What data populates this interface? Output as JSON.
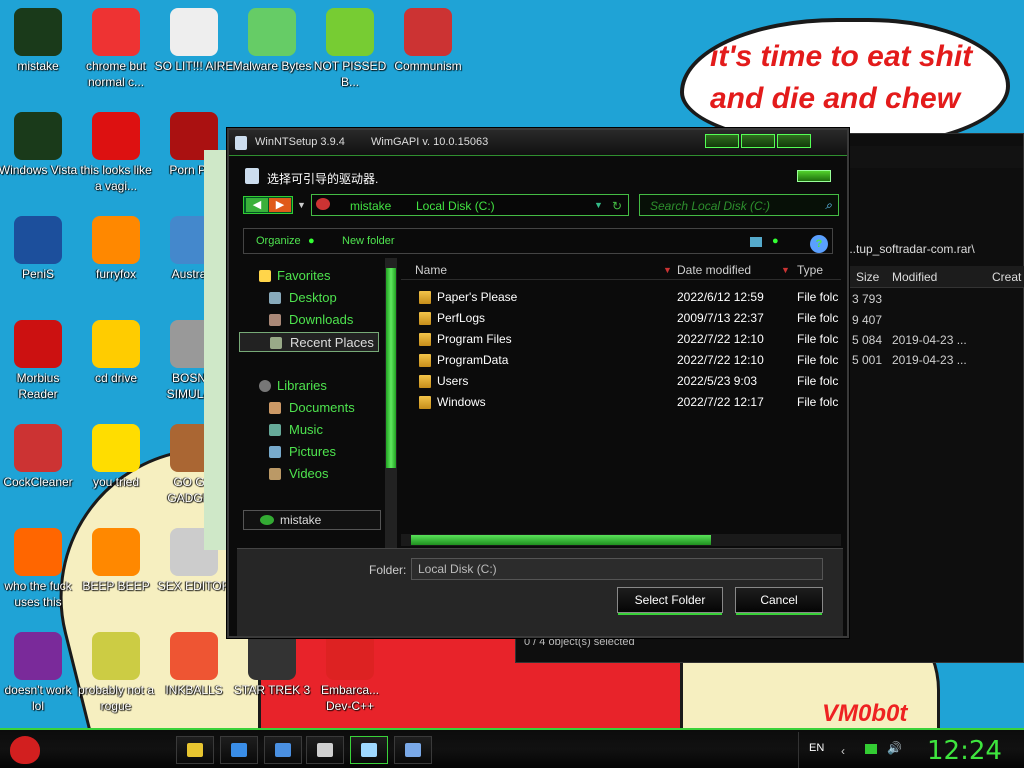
{
  "wallpaper": {
    "bubble_text": "it's time to eat shit and die and chew bubble gum",
    "signature": "VM0b0t"
  },
  "desktop_icons": [
    {
      "label": "mistake",
      "icon": "alienware-icon",
      "color": "#1a3a1a"
    },
    {
      "label": "chrome but normal c...",
      "icon": "chrome-icon",
      "color": "#e33"
    },
    {
      "label": "SO LIT!!! AIRE",
      "icon": "solitaire-icon",
      "color": "#eee"
    },
    {
      "label": "Malware Bytes",
      "icon": "shield-icon",
      "color": "#6c6"
    },
    {
      "label": "NOT PISSED B...",
      "icon": "bad-piggies-icon",
      "color": "#7c3"
    },
    {
      "label": "Communism",
      "icon": "communism-icon",
      "color": "#c33"
    },
    {
      "label": "Windows Vista",
      "icon": "alienware-icon",
      "color": "#1a3a1a"
    },
    {
      "label": "this looks like a vagi...",
      "icon": "opera-icon",
      "color": "#d11"
    },
    {
      "label": "Porn Pl...",
      "icon": "flash-icon",
      "color": "#a11"
    },
    {
      "label": "PeniS",
      "icon": "photoshop-icon",
      "color": "#1c4f9c"
    },
    {
      "label": "furryfox",
      "icon": "firefox-icon",
      "color": "#f80"
    },
    {
      "label": "Austra...",
      "icon": "globe-icon",
      "color": "#48c"
    },
    {
      "label": "Morbius Reader",
      "icon": "pdf-icon",
      "color": "#c11"
    },
    {
      "label": "cd drive",
      "icon": "cd-icon",
      "color": "#fc0"
    },
    {
      "label": "BOSN... SIMULA...",
      "icon": "spikeball-icon",
      "color": "#999"
    },
    {
      "label": "CockCleaner",
      "icon": "ccleaner-icon",
      "color": "#c33"
    },
    {
      "label": "you tried",
      "icon": "star-icon",
      "color": "#fd0"
    },
    {
      "label": "GO G... GADGE...",
      "icon": "briefcase-icon",
      "color": "#a63"
    },
    {
      "label": "who the fuck uses this",
      "icon": "lightning-icon",
      "color": "#f60"
    },
    {
      "label": "BEEP BEEP",
      "icon": "vlc-icon",
      "color": "#f80"
    },
    {
      "label": "SEX EDITOR",
      "icon": "hex-editor-icon",
      "color": "#ccc"
    },
    {
      "label": "doesn't work lol",
      "icon": "yahoo-icon",
      "color": "#7a2a9a"
    },
    {
      "label": "probably not a rogue",
      "icon": "gear-icon",
      "color": "#cc4"
    },
    {
      "label": "INKBALLS",
      "icon": "inkball-icon",
      "color": "#e53"
    },
    {
      "label": "STAR TREK 3",
      "icon": "star-trek-icon",
      "color": "#333"
    },
    {
      "label": "Embarca... Dev-C++",
      "icon": "devcpp-icon",
      "color": "#d22"
    }
  ],
  "background_window": {
    "path": "...softradar-com.rar\\",
    "path2": "...tup_softradar-com.rar\\",
    "columns": [
      "Size",
      "Modified",
      "Creat"
    ],
    "rows": [
      {
        "size": "3 793",
        "modified": ""
      },
      {
        "size": "9 407",
        "modified": ""
      },
      {
        "size": "5 084",
        "modified": "2019-04-23 ..."
      },
      {
        "size": "5 001",
        "modified": "2019-04-23 ..."
      }
    ],
    "status": "0 / 4 object(s) selected"
  },
  "dialog": {
    "title": "WinNTSetup 3.9.4",
    "subtitle": "WimGAPI v. 10.0.15063",
    "caption": "选择可引导的驱动器.",
    "address": {
      "user": "mistake",
      "location": "Local Disk (C:)"
    },
    "search_placeholder": "Search Local Disk (C:)",
    "toolbar": {
      "organize": "Organize",
      "new_folder": "New folder",
      "help": "?"
    },
    "nav": {
      "favorites": "Favorites",
      "desktop": "Desktop",
      "downloads": "Downloads",
      "recent": "Recent Places",
      "libraries": "Libraries",
      "documents": "Documents",
      "music": "Music",
      "pictures": "Pictures",
      "videos": "Videos",
      "drive": "mistake"
    },
    "columns": {
      "name": "Name",
      "date": "Date modified",
      "type": "Type"
    },
    "files": [
      {
        "name": "Paper's Please",
        "date": "2022/6/12 12:59",
        "type": "File folc"
      },
      {
        "name": "PerfLogs",
        "date": "2009/7/13 22:37",
        "type": "File folc"
      },
      {
        "name": "Program Files",
        "date": "2022/7/22 12:10",
        "type": "File folc"
      },
      {
        "name": "ProgramData",
        "date": "2022/7/22 12:10",
        "type": "File folc"
      },
      {
        "name": "Users",
        "date": "2022/5/23 9:03",
        "type": "File folc"
      },
      {
        "name": "Windows",
        "date": "2022/7/22 12:17",
        "type": "File folc"
      }
    ],
    "folder_label": "Folder:",
    "folder_value": "Local Disk (C:)",
    "select_button": "Select Folder",
    "cancel_button": "Cancel"
  },
  "taskbar": {
    "items": [
      "explorer",
      "chrome",
      "windows",
      "7zip",
      "winntsetup",
      "remote"
    ],
    "language": "EN",
    "clock": "12:24",
    "accent": "#3ad23a"
  }
}
